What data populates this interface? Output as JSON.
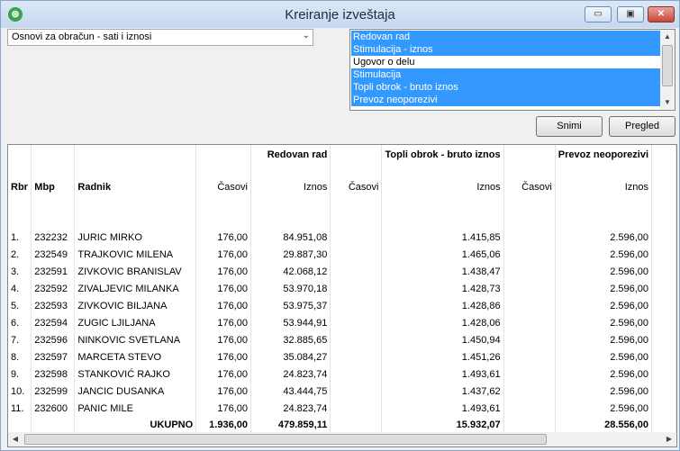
{
  "window": {
    "title": "Kreiranje izveštaja",
    "minimize": "▭",
    "maximize": "▣",
    "close": "✕"
  },
  "basis_combo": {
    "value": "Osnovi za obračun - sati i iznosi",
    "arrow": "⌄"
  },
  "listbox": {
    "items": [
      {
        "label": "Redovan rad",
        "selected": true
      },
      {
        "label": "Stimulacija - iznos",
        "selected": true
      },
      {
        "label": "Ugovor o delu",
        "selected": false
      },
      {
        "label": "Stimulacija",
        "selected": true
      },
      {
        "label": "Topli obrok - bruto iznos",
        "selected": true
      },
      {
        "label": "Prevoz neoporezivi",
        "selected": true
      },
      {
        "label": "",
        "selected": false
      }
    ]
  },
  "buttons": {
    "save": "Snimi",
    "preview": "Pregled"
  },
  "table": {
    "groups": [
      "Redovan rad",
      "Topli obrok - bruto iznos",
      "Prevoz neoporezivi"
    ],
    "headers": {
      "rbr": "Rbr",
      "mbp": "Mbp",
      "radnik": "Radnik",
      "casovi": "Časovi",
      "iznos": "Iznos"
    },
    "rows": [
      {
        "rbr": "1.",
        "mbp": "232232",
        "radnik": "JURIC MIRKO",
        "c1": "176,00",
        "i1": "84.951,08",
        "c2": "",
        "i2": "1.415,85",
        "c3": "",
        "i3": "2.596,00"
      },
      {
        "rbr": "2.",
        "mbp": "232549",
        "radnik": "TRAJKOVIC MILENA",
        "c1": "176,00",
        "i1": "29.887,30",
        "c2": "",
        "i2": "1.465,06",
        "c3": "",
        "i3": "2.596,00"
      },
      {
        "rbr": "3.",
        "mbp": "232591",
        "radnik": "ZIVKOVIC BRANISLAV",
        "c1": "176,00",
        "i1": "42.068,12",
        "c2": "",
        "i2": "1.438,47",
        "c3": "",
        "i3": "2.596,00"
      },
      {
        "rbr": "4.",
        "mbp": "232592",
        "radnik": "ZIVALJEVIC MILANKA",
        "c1": "176,00",
        "i1": "53.970,18",
        "c2": "",
        "i2": "1.428,73",
        "c3": "",
        "i3": "2.596,00"
      },
      {
        "rbr": "5.",
        "mbp": "232593",
        "radnik": "ZIVKOVIC BILJANA",
        "c1": "176,00",
        "i1": "53.975,37",
        "c2": "",
        "i2": "1.428,86",
        "c3": "",
        "i3": "2.596,00"
      },
      {
        "rbr": "6.",
        "mbp": "232594",
        "radnik": "ZUGIC LJILJANA",
        "c1": "176,00",
        "i1": "53.944,91",
        "c2": "",
        "i2": "1.428,06",
        "c3": "",
        "i3": "2.596,00"
      },
      {
        "rbr": "7.",
        "mbp": "232596",
        "radnik": "NINKOVIC SVETLANA",
        "c1": "176,00",
        "i1": "32.885,65",
        "c2": "",
        "i2": "1.450,94",
        "c3": "",
        "i3": "2.596,00"
      },
      {
        "rbr": "8.",
        "mbp": "232597",
        "radnik": "MARCETA STEVO",
        "c1": "176,00",
        "i1": "35.084,27",
        "c2": "",
        "i2": "1.451,26",
        "c3": "",
        "i3": "2.596,00"
      },
      {
        "rbr": "9.",
        "mbp": "232598",
        "radnik": "STANKOVIĆ RAJKO",
        "c1": "176,00",
        "i1": "24.823,74",
        "c2": "",
        "i2": "1.493,61",
        "c3": "",
        "i3": "2.596,00"
      },
      {
        "rbr": "10.",
        "mbp": "232599",
        "radnik": "JANCIC DUSANKA",
        "c1": "176,00",
        "i1": "43.444,75",
        "c2": "",
        "i2": "1.437,62",
        "c3": "",
        "i3": "2.596,00"
      },
      {
        "rbr": "11.",
        "mbp": "232600",
        "radnik": "PANIC MILE",
        "c1": "176,00",
        "i1": "24.823,74",
        "c2": "",
        "i2": "1.493,61",
        "c3": "",
        "i3": "2.596,00"
      }
    ],
    "total": {
      "label": "UKUPNO",
      "c1": "1.936,00",
      "i1": "479.859,11",
      "c2": "",
      "i2": "15.932,07",
      "c3": "",
      "i3": "28.556,00"
    }
  },
  "scroll": {
    "left": "◀",
    "right": "▶",
    "up": "▲",
    "down": "▼"
  }
}
